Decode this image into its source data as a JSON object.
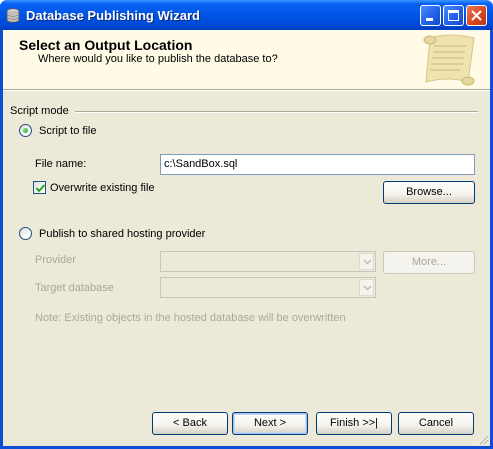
{
  "window": {
    "title": "Database Publishing Wizard"
  },
  "header": {
    "title": "Select an Output Location",
    "subtitle": "Where would you like to publish the database to?"
  },
  "script_mode": {
    "group_label": "Script mode",
    "script_to_file": {
      "label": "Script to file",
      "selected": true,
      "file_name_label": "File name:",
      "file_name_value": "c:\\SandBox.sql",
      "overwrite_label": "Overwrite existing file",
      "overwrite_checked": true,
      "browse_label": "Browse..."
    },
    "publish_to_host": {
      "label": "Publish to shared hosting provider",
      "selected": false,
      "provider_label": "Provider",
      "provider_value": "",
      "more_label": "More...",
      "target_db_label": "Target database",
      "target_db_value": "",
      "note": "Note: Existing objects in the hosted database will be overwritten"
    }
  },
  "buttons": {
    "back": "< Back",
    "next": "Next >",
    "finish": "Finish >>|",
    "cancel": "Cancel"
  },
  "colors": {
    "titlebar": "#0055e5",
    "dialog_bg": "#ece9d8",
    "header_bg": "#fffbe7",
    "disabled_text": "#aca899",
    "radio_dot": "#21a121"
  },
  "icons": [
    "database-icon",
    "minimize-icon",
    "maximize-icon",
    "close-icon",
    "scroll-icon",
    "checkmark-icon",
    "chevron-down-icon",
    "resize-grip-icon"
  ]
}
